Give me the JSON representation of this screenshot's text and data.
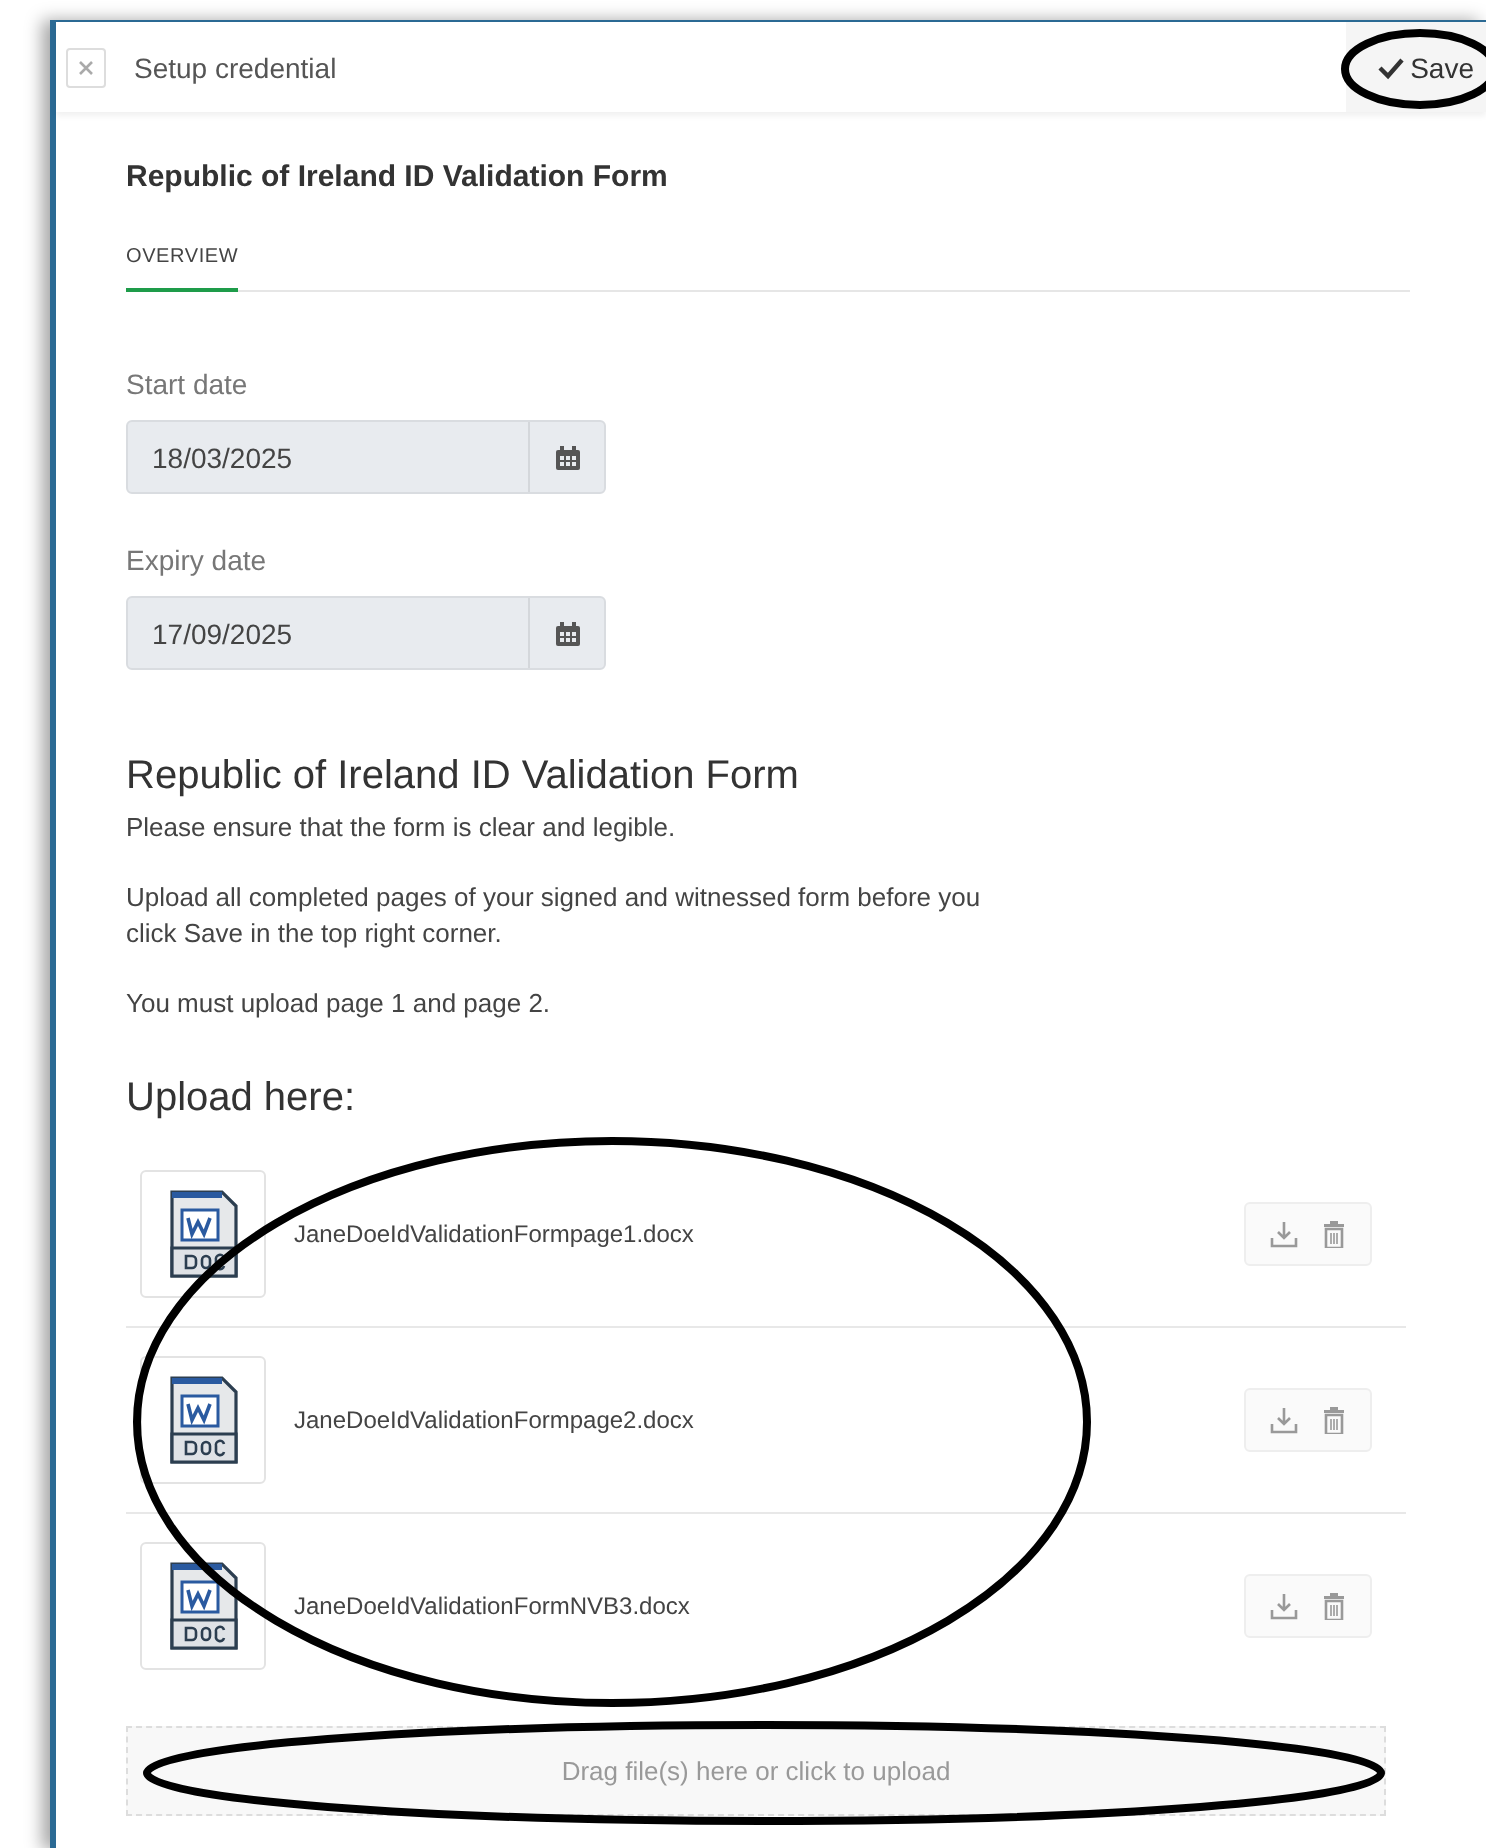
{
  "window": {
    "title": "Setup credential",
    "save_label": "Save"
  },
  "form_title": "Republic of Ireland ID Validation Form",
  "tabs": [
    {
      "label": "OVERVIEW",
      "selected": true
    }
  ],
  "fields": [
    {
      "label": "Start date",
      "value": "18/03/2025"
    },
    {
      "label": "Expiry date",
      "value": "17/09/2025"
    }
  ],
  "section": {
    "heading": "Republic of Ireland ID Validation Form",
    "paragraphs": [
      "Please ensure that the form is clear and legible.",
      "Upload all completed pages of your signed and witnessed form before you click Save in the top right corner.",
      "You must upload page 1 and page 2."
    ]
  },
  "upload": {
    "heading": "Upload here:",
    "files": [
      {
        "name": "JaneDoeIdValidationFormpage1.docx"
      },
      {
        "name": "JaneDoeIdValidationFormpage2.docx"
      },
      {
        "name": "JaneDoeIdValidationFormNVB3.docx"
      }
    ],
    "dropzone": "Drag file(s) here or click to upload"
  },
  "annotations": {
    "save": true,
    "files": true,
    "dropzone": true
  }
}
